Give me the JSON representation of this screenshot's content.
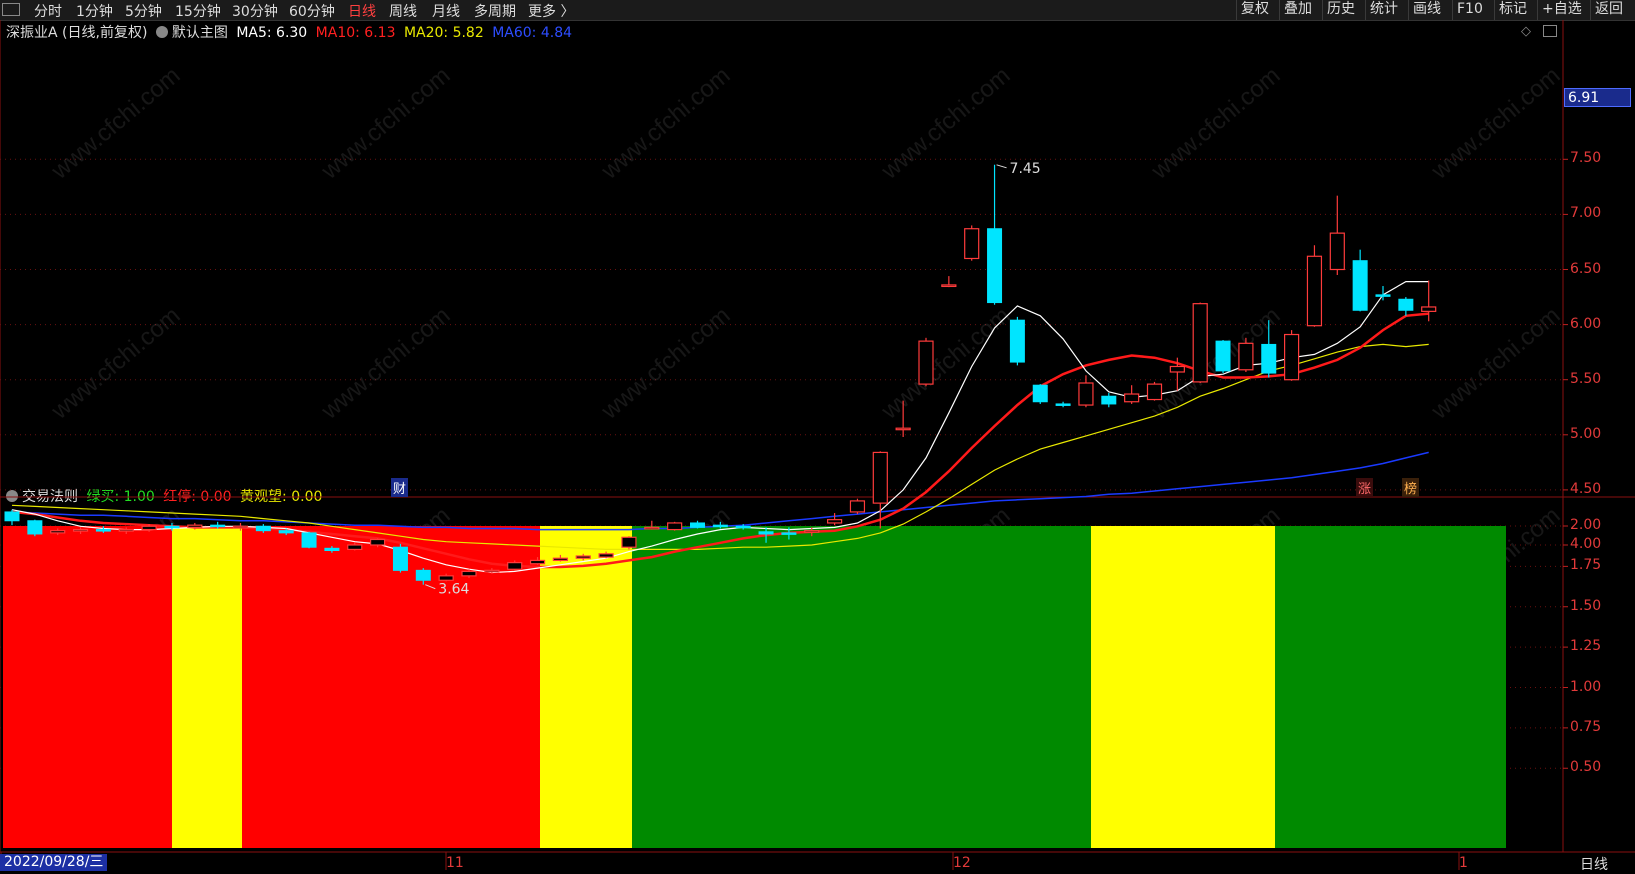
{
  "toolbar": {
    "periods": [
      "分时",
      "1分钟",
      "5分钟",
      "15分钟",
      "30分钟",
      "60分钟",
      "日线",
      "周线",
      "月线",
      "多周期",
      "更多 〉"
    ],
    "active_period": "日线",
    "right_buttons": [
      "复权",
      "叠加",
      "历史",
      "统计",
      "画线",
      "F10",
      "标记",
      "+自选",
      "返回"
    ]
  },
  "main_chart": {
    "stock_title": "深振业A (日线,前复权)",
    "template_name": "默认主图",
    "ma5": "MA5: 6.30",
    "ma10": "MA10: 6.13",
    "ma20": "MA20: 5.82",
    "ma60": "MA60: 4.84",
    "high_label": "7.45",
    "low_label": "3.64",
    "current_price_tag": "6.91",
    "y_ticks": [
      "7.50",
      "7.00",
      "6.50",
      "6.00",
      "5.50",
      "5.00",
      "4.50",
      "4.00"
    ],
    "markers": {
      "finance": "财",
      "limit_up": "涨",
      "ranking": "榜"
    },
    "colors": {
      "up": "#ff3b3b",
      "down": "#00e5ff",
      "ma5": "#ffffff",
      "ma10": "#ff1a1a",
      "ma20": "#e8e800",
      "ma60": "#1a3aff"
    }
  },
  "sub_chart": {
    "indicator_name": "交易法则",
    "green_buy": "绿买: 1.00",
    "red_stop": "红停: 0.00",
    "yellow_watch": "黄观望: 0.00",
    "y_ticks": [
      "2.00",
      "1.75",
      "1.50",
      "1.25",
      "1.00",
      "0.75",
      "0.50"
    ],
    "segments": [
      {
        "color": "red",
        "bars": 7
      },
      {
        "color": "yellow",
        "bars": 3
      },
      {
        "color": "red",
        "bars": 13
      },
      {
        "color": "yellow",
        "bars": 4
      },
      {
        "color": "green",
        "bars": 20
      },
      {
        "color": "yellow",
        "bars": 8
      },
      {
        "color": "green",
        "bars": 10
      }
    ],
    "colors": {
      "red": "#ff0000",
      "yellow": "#ffff00",
      "green": "#008a00"
    }
  },
  "x_axis": {
    "start_date": "2022/09/28/三",
    "month_labels": [
      "11",
      "12",
      "1"
    ],
    "period": "日线"
  },
  "watermark": "www.cfchi.com",
  "chart_data": {
    "type": "candlestick",
    "ylim": [
      3.5,
      7.6
    ],
    "candles": [
      [
        4.3,
        4.22,
        4.32,
        4.18
      ],
      [
        4.22,
        4.1,
        4.23,
        4.08
      ],
      [
        4.11,
        4.13,
        4.15,
        4.09
      ],
      [
        4.13,
        4.14,
        4.16,
        4.1
      ],
      [
        4.14,
        4.13,
        4.17,
        4.11
      ],
      [
        4.13,
        4.14,
        4.16,
        4.1
      ],
      [
        4.14,
        4.17,
        4.19,
        4.12
      ],
      [
        4.17,
        4.16,
        4.2,
        4.13
      ],
      [
        4.16,
        4.18,
        4.2,
        4.14
      ],
      [
        4.18,
        4.17,
        4.21,
        4.15
      ],
      [
        4.17,
        4.17,
        4.2,
        4.13
      ],
      [
        4.17,
        4.13,
        4.19,
        4.11
      ],
      [
        4.13,
        4.11,
        4.15,
        4.09
      ],
      [
        4.11,
        3.98,
        4.12,
        3.97
      ],
      [
        3.97,
        3.95,
        3.99,
        3.93
      ],
      [
        3.96,
        4.0,
        4.02,
        3.95
      ],
      [
        4.0,
        4.05,
        4.06,
        3.98
      ],
      [
        3.98,
        3.77,
        4.01,
        3.75
      ],
      [
        3.77,
        3.68,
        3.79,
        3.64
      ],
      [
        3.68,
        3.72,
        3.74,
        3.67
      ],
      [
        3.72,
        3.76,
        3.78,
        3.7
      ],
      [
        3.76,
        3.77,
        3.79,
        3.74
      ],
      [
        3.78,
        3.84,
        3.86,
        3.77
      ],
      [
        3.83,
        3.86,
        3.89,
        3.82
      ],
      [
        3.86,
        3.88,
        3.91,
        3.85
      ],
      [
        3.88,
        3.9,
        3.92,
        3.86
      ],
      [
        3.89,
        3.92,
        3.94,
        3.88
      ],
      [
        3.98,
        4.07,
        4.08,
        3.96
      ],
      [
        4.16,
        4.16,
        4.22,
        4.14
      ],
      [
        4.14,
        4.2,
        4.21,
        4.13
      ],
      [
        4.2,
        4.16,
        4.22,
        4.15
      ],
      [
        4.18,
        4.17,
        4.21,
        4.15
      ],
      [
        4.17,
        4.16,
        4.19,
        4.14
      ],
      [
        4.12,
        4.1,
        4.16,
        4.02
      ],
      [
        4.11,
        4.1,
        4.16,
        4.05
      ],
      [
        4.13,
        4.13,
        4.16,
        4.08
      ],
      [
        4.2,
        4.23,
        4.29,
        4.18
      ],
      [
        4.3,
        4.4,
        4.42,
        4.28
      ],
      [
        4.38,
        4.84,
        4.85,
        4.15
      ],
      [
        5.05,
        5.06,
        5.31,
        4.98
      ],
      [
        5.46,
        5.85,
        5.88,
        5.44
      ],
      [
        6.36,
        6.36,
        6.44,
        6.34
      ],
      [
        6.6,
        6.87,
        6.9,
        6.58
      ],
      [
        6.87,
        6.2,
        7.45,
        6.18
      ],
      [
        6.04,
        5.66,
        6.07,
        5.63
      ],
      [
        5.45,
        5.3,
        5.46,
        5.28
      ],
      [
        5.28,
        5.27,
        5.3,
        5.25
      ],
      [
        5.27,
        5.47,
        5.54,
        5.25
      ],
      [
        5.35,
        5.28,
        5.38,
        5.25
      ],
      [
        5.3,
        5.37,
        5.45,
        5.28
      ],
      [
        5.32,
        5.46,
        5.48,
        5.31
      ],
      [
        5.57,
        5.62,
        5.7,
        5.4
      ],
      [
        5.48,
        6.19,
        6.2,
        5.47
      ],
      [
        5.85,
        5.58,
        5.86,
        5.56
      ],
      [
        5.59,
        5.83,
        5.88,
        5.57
      ],
      [
        5.82,
        5.56,
        6.04,
        5.52
      ],
      [
        5.5,
        5.91,
        5.95,
        5.49
      ],
      [
        5.99,
        6.62,
        6.72,
        5.98
      ],
      [
        6.5,
        6.83,
        7.17,
        6.45
      ],
      [
        6.58,
        6.13,
        6.68,
        6.12
      ],
      [
        6.27,
        6.26,
        6.35,
        6.22
      ],
      [
        6.23,
        6.13,
        6.25,
        6.08
      ],
      [
        6.12,
        6.16,
        6.4,
        6.03
      ]
    ],
    "ma5": [
      4.32,
      4.28,
      4.22,
      4.17,
      4.15,
      4.14,
      4.14,
      4.15,
      4.16,
      4.17,
      4.17,
      4.16,
      4.15,
      4.11,
      4.07,
      4.03,
      4.01,
      3.95,
      3.88,
      3.82,
      3.78,
      3.75,
      3.76,
      3.79,
      3.82,
      3.85,
      3.88,
      3.94,
      3.99,
      4.05,
      4.1,
      4.14,
      4.16,
      4.15,
      4.14,
      4.15,
      4.16,
      4.2,
      4.31,
      4.5,
      4.79,
      5.2,
      5.62,
      5.97,
      6.17,
      6.08,
      5.87,
      5.58,
      5.39,
      5.34,
      5.36,
      5.4,
      5.53,
      5.55,
      5.63,
      5.65,
      5.7,
      5.73,
      5.83,
      5.98,
      6.27,
      6.39,
      6.39
    ],
    "ma10": [
      4.3,
      4.28,
      4.25,
      4.22,
      4.2,
      4.19,
      4.18,
      4.17,
      4.16,
      4.16,
      4.16,
      4.15,
      4.14,
      4.12,
      4.1,
      4.08,
      4.06,
      4.02,
      3.97,
      3.92,
      3.87,
      3.83,
      3.81,
      3.8,
      3.8,
      3.81,
      3.83,
      3.86,
      3.89,
      3.94,
      3.98,
      4.02,
      4.06,
      4.09,
      4.11,
      4.12,
      4.13,
      4.17,
      4.23,
      4.33,
      4.48,
      4.67,
      4.88,
      5.08,
      5.27,
      5.44,
      5.55,
      5.63,
      5.68,
      5.72,
      5.7,
      5.65,
      5.58,
      5.52,
      5.52,
      5.53,
      5.55,
      5.61,
      5.68,
      5.79,
      5.95,
      6.08,
      6.1
    ],
    "ma20": [
      4.36,
      4.35,
      4.34,
      4.33,
      4.32,
      4.31,
      4.3,
      4.29,
      4.28,
      4.27,
      4.26,
      4.24,
      4.22,
      4.2,
      4.17,
      4.14,
      4.11,
      4.08,
      4.05,
      4.03,
      4.02,
      4.01,
      4.0,
      3.99,
      3.98,
      3.97,
      3.96,
      3.96,
      3.96,
      3.96,
      3.96,
      3.97,
      3.98,
      3.98,
      3.99,
      4.0,
      4.03,
      4.06,
      4.11,
      4.19,
      4.3,
      4.42,
      4.55,
      4.68,
      4.78,
      4.87,
      4.93,
      4.99,
      5.05,
      5.11,
      5.17,
      5.25,
      5.35,
      5.42,
      5.5,
      5.58,
      5.63,
      5.69,
      5.75,
      5.8,
      5.82,
      5.8,
      5.82
    ],
    "ma60": [
      4.3,
      4.29,
      4.28,
      4.27,
      4.27,
      4.26,
      4.25,
      4.24,
      4.24,
      4.23,
      4.22,
      4.22,
      4.21,
      4.2,
      4.19,
      4.18,
      4.18,
      4.17,
      4.16,
      4.16,
      4.15,
      4.15,
      4.15,
      4.14,
      4.14,
      4.14,
      4.14,
      4.14,
      4.15,
      4.15,
      4.16,
      4.17,
      4.18,
      4.2,
      4.22,
      4.24,
      4.26,
      4.28,
      4.3,
      4.32,
      4.34,
      4.36,
      4.38,
      4.4,
      4.41,
      4.42,
      4.43,
      4.44,
      4.46,
      4.47,
      4.49,
      4.51,
      4.53,
      4.55,
      4.57,
      4.59,
      4.61,
      4.64,
      4.67,
      4.7,
      4.74,
      4.79,
      4.84
    ]
  }
}
